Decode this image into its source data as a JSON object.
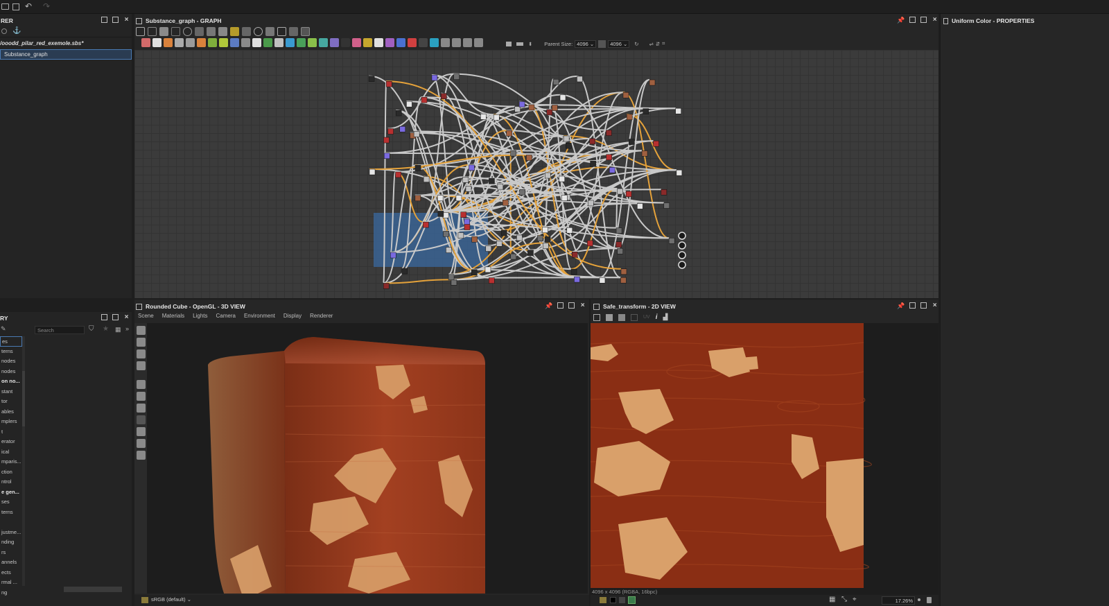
{
  "topbar": {
    "icons": [
      "open-icon",
      "save-icon",
      "undo-icon",
      "redo-icon"
    ]
  },
  "explorer": {
    "title": "RER",
    "file": "/ooodd_pilar_red_exemole.sbs*",
    "graph_item": "Substance_graph"
  },
  "library": {
    "title": "RY",
    "search_placeholder": "Search",
    "items": [
      "es",
      "terns",
      "nodes",
      "nodes",
      "on no...",
      "stant",
      "tor",
      "ables",
      "mplers",
      "t",
      "erator",
      "ical",
      "mparis...",
      "ction",
      "ntrol",
      "e gen...",
      "ses",
      "terns",
      "",
      "justme...",
      "nding",
      "rs",
      "annels",
      "ects",
      "rmal ...",
      "ng"
    ],
    "bold_items": [
      4,
      15
    ]
  },
  "graph": {
    "title": "Substance_graph - GRAPH",
    "parent_size_label": "Parent Size:",
    "parent_size": "4096",
    "size_value": "4096"
  },
  "properties": {
    "title": "Uniform Color - PROPERTIES"
  },
  "view3d": {
    "title": "Rounded Cube - OpenGL - 3D VIEW",
    "menu": [
      "Scene",
      "Materials",
      "Lights",
      "Camera",
      "Environment",
      "Display",
      "Renderer"
    ],
    "colorspace": "sRGB (default)"
  },
  "view2d": {
    "title": "Safe_transform - 2D VIEW",
    "uv_label": "UV",
    "info": "4096 x 4096 (RGBA, 16bpc)",
    "zoom": "17.26%"
  },
  "colors": {
    "panel": "#262626",
    "graph_bg": "#3a3a3a",
    "accent_blue": "#3b6aa0",
    "wood_dark": "#8a2e14",
    "wood_light": "#d9a06a"
  }
}
